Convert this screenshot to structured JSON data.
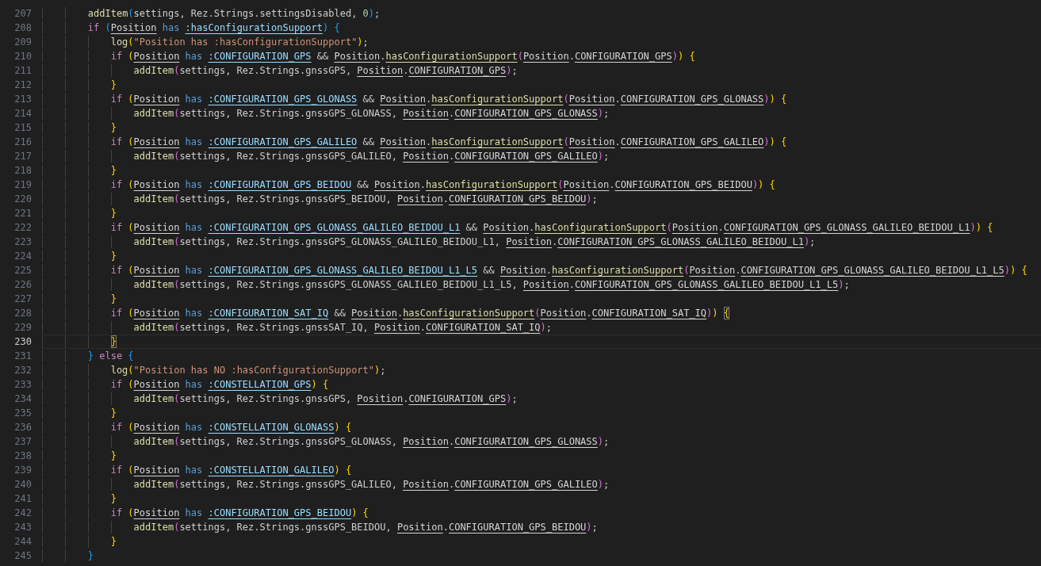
{
  "editor": {
    "lines": [
      {
        "number": "207",
        "current": false,
        "tokens": [
          {
            "kind": "fn",
            "text": "addItem"
          },
          {
            "kind": "b3",
            "text": "("
          },
          {
            "kind": "plain",
            "text": "settings, Rez.Strings.settingsDisabled,",
            "spaced": true
          },
          {
            "kind": "num",
            "text": "0"
          },
          {
            "kind": "b3",
            "text": ")"
          },
          {
            "kind": "plain",
            "text": ";"
          }
        ]
      },
      {
        "number": "208",
        "current": false,
        "tokens": [
          {
            "kind": "kw",
            "text": "if",
            "spaced": true
          },
          {
            "kind": "b3",
            "text": "("
          },
          {
            "kind": "mod",
            "text": "Position",
            "spaced": true
          },
          {
            "kind": "op",
            "text": "has",
            "spaced": true
          },
          {
            "kind": "sym",
            "text": ":hasConfigurationSupport"
          },
          {
            "kind": "b3",
            "text": ")",
            "spaced": true
          },
          {
            "kind": "b3",
            "text": "{"
          }
        ],
        "children": [
          {
            "number": "209",
            "current": false,
            "tokens": [
              {
                "kind": "fn",
                "text": "log"
              },
              {
                "kind": "b1",
                "text": "("
              },
              {
                "kind": "str",
                "text": "\"Position has :hasConfigurationSupport\""
              },
              {
                "kind": "b1",
                "text": ")"
              },
              {
                "kind": "plain",
                "text": ";"
              }
            ]
          },
          {
            "number": "210",
            "current": false,
            "tokens": [
              {
                "kind": "kw",
                "text": "if",
                "spaced": true
              },
              {
                "kind": "b1",
                "text": "("
              },
              {
                "kind": "mod",
                "text": "Position",
                "spaced": true
              },
              {
                "kind": "op",
                "text": "has",
                "spaced": true
              },
              {
                "kind": "sym",
                "text": ":CONFIGURATION_GPS",
                "spaced": true
              },
              {
                "kind": "plain",
                "text": "&&",
                "spaced": true
              },
              {
                "kind": "mod",
                "text": "Position"
              },
              {
                "kind": "plain",
                "text": "."
              },
              {
                "kind": "method",
                "text": "hasConfigurationSupport"
              },
              {
                "kind": "b2",
                "text": "("
              },
              {
                "kind": "mod",
                "text": "Position"
              },
              {
                "kind": "plain",
                "text": "."
              },
              {
                "kind": "const",
                "text": "CONFIGURATION_GPS"
              },
              {
                "kind": "b2",
                "text": ")"
              },
              {
                "kind": "b1",
                "text": ")",
                "spaced": true
              },
              {
                "kind": "b1",
                "text": "{"
              }
            ],
            "children": [
              {
                "number": "211",
                "current": false,
                "tokens": [
                  {
                    "kind": "fn",
                    "text": "addItem"
                  },
                  {
                    "kind": "b2",
                    "text": "("
                  },
                  {
                    "kind": "plain",
                    "text": "settings, Rez.Strings.gnssGPS,",
                    "spaced": true
                  },
                  {
                    "kind": "mod",
                    "text": "Position"
                  },
                  {
                    "kind": "plain",
                    "text": "."
                  },
                  {
                    "kind": "const",
                    "text": "CONFIGURATION_GPS"
                  },
                  {
                    "kind": "b2",
                    "text": ")"
                  },
                  {
                    "kind": "plain",
                    "text": ";"
                  }
                ]
              }
            ]
          },
          {
            "number": "212",
            "current": false,
            "tokens": [
              {
                "kind": "b1",
                "text": "}"
              }
            ]
          },
          {
            "number": "213",
            "current": false,
            "tokens": [
              {
                "kind": "kw",
                "text": "if",
                "spaced": true
              },
              {
                "kind": "b1",
                "text": "("
              },
              {
                "kind": "mod",
                "text": "Position",
                "spaced": true
              },
              {
                "kind": "op",
                "text": "has",
                "spaced": true
              },
              {
                "kind": "sym",
                "text": ":CONFIGURATION_GPS_GLONASS",
                "spaced": true
              },
              {
                "kind": "plain",
                "text": "&&",
                "spaced": true
              },
              {
                "kind": "mod",
                "text": "Position"
              },
              {
                "kind": "plain",
                "text": "."
              },
              {
                "kind": "method",
                "text": "hasConfigurationSupport"
              },
              {
                "kind": "b2",
                "text": "("
              },
              {
                "kind": "mod",
                "text": "Position"
              },
              {
                "kind": "plain",
                "text": "."
              },
              {
                "kind": "const",
                "text": "CONFIGURATION_GPS_GLONASS"
              },
              {
                "kind": "b2",
                "text": ")"
              },
              {
                "kind": "b1",
                "text": ")",
                "spaced": true
              },
              {
                "kind": "b1",
                "text": "{"
              }
            ],
            "children": [
              {
                "number": "214",
                "current": false,
                "tokens": [
                  {
                    "kind": "fn",
                    "text": "addItem"
                  },
                  {
                    "kind": "b2",
                    "text": "("
                  },
                  {
                    "kind": "plain",
                    "text": "settings, Rez.Strings.gnssGPS_GLONASS,",
                    "spaced": true
                  },
                  {
                    "kind": "mod",
                    "text": "Position"
                  },
                  {
                    "kind": "plain",
                    "text": "."
                  },
                  {
                    "kind": "const",
                    "text": "CONFIGURATION_GPS_GLONASS"
                  },
                  {
                    "kind": "b2",
                    "text": ")"
                  },
                  {
                    "kind": "plain",
                    "text": ";"
                  }
                ]
              }
            ]
          },
          {
            "number": "215",
            "current": false,
            "tokens": [
              {
                "kind": "b1",
                "text": "}"
              }
            ]
          },
          {
            "number": "216",
            "current": false,
            "tokens": [
              {
                "kind": "kw",
                "text": "if",
                "spaced": true
              },
              {
                "kind": "b1",
                "text": "("
              },
              {
                "kind": "mod",
                "text": "Position",
                "spaced": true
              },
              {
                "kind": "op",
                "text": "has",
                "spaced": true
              },
              {
                "kind": "sym",
                "text": ":CONFIGURATION_GPS_GALILEO",
                "spaced": true
              },
              {
                "kind": "plain",
                "text": "&&",
                "spaced": true
              },
              {
                "kind": "mod",
                "text": "Position"
              },
              {
                "kind": "plain",
                "text": "."
              },
              {
                "kind": "method",
                "text": "hasConfigurationSupport"
              },
              {
                "kind": "b2",
                "text": "("
              },
              {
                "kind": "mod",
                "text": "Position"
              },
              {
                "kind": "plain",
                "text": "."
              },
              {
                "kind": "const",
                "text": "CONFIGURATION_GPS_GALILEO"
              },
              {
                "kind": "b2",
                "text": ")"
              },
              {
                "kind": "b1",
                "text": ")",
                "spaced": true
              },
              {
                "kind": "b1",
                "text": "{"
              }
            ],
            "children": [
              {
                "number": "217",
                "current": false,
                "tokens": [
                  {
                    "kind": "fn",
                    "text": "addItem"
                  },
                  {
                    "kind": "b2",
                    "text": "("
                  },
                  {
                    "kind": "plain",
                    "text": "settings, Rez.Strings.gnssGPS_GALILEO,",
                    "spaced": true
                  },
                  {
                    "kind": "mod",
                    "text": "Position"
                  },
                  {
                    "kind": "plain",
                    "text": "."
                  },
                  {
                    "kind": "const",
                    "text": "CONFIGURATION_GPS_GALILEO"
                  },
                  {
                    "kind": "b2",
                    "text": ")"
                  },
                  {
                    "kind": "plain",
                    "text": ";"
                  }
                ]
              }
            ]
          },
          {
            "number": "218",
            "current": false,
            "tokens": [
              {
                "kind": "b1",
                "text": "}"
              }
            ]
          },
          {
            "number": "219",
            "current": false,
            "tokens": [
              {
                "kind": "kw",
                "text": "if",
                "spaced": true
              },
              {
                "kind": "b1",
                "text": "("
              },
              {
                "kind": "mod",
                "text": "Position",
                "spaced": true
              },
              {
                "kind": "op",
                "text": "has",
                "spaced": true
              },
              {
                "kind": "sym",
                "text": ":CONFIGURATION_GPS_BEIDOU",
                "spaced": true
              },
              {
                "kind": "plain",
                "text": "&&",
                "spaced": true
              },
              {
                "kind": "mod",
                "text": "Position"
              },
              {
                "kind": "plain",
                "text": "."
              },
              {
                "kind": "method",
                "text": "hasConfigurationSupport"
              },
              {
                "kind": "b2",
                "text": "("
              },
              {
                "kind": "mod",
                "text": "Position"
              },
              {
                "kind": "plain",
                "text": "."
              },
              {
                "kind": "const",
                "text": "CONFIGURATION_GPS_BEIDOU"
              },
              {
                "kind": "b2",
                "text": ")"
              },
              {
                "kind": "b1",
                "text": ")",
                "spaced": true
              },
              {
                "kind": "b1",
                "text": "{"
              }
            ],
            "children": [
              {
                "number": "220",
                "current": false,
                "tokens": [
                  {
                    "kind": "fn",
                    "text": "addItem"
                  },
                  {
                    "kind": "b2",
                    "text": "("
                  },
                  {
                    "kind": "plain",
                    "text": "settings, Rez.Strings.gnssGPS_BEIDOU,",
                    "spaced": true
                  },
                  {
                    "kind": "mod",
                    "text": "Position"
                  },
                  {
                    "kind": "plain",
                    "text": "."
                  },
                  {
                    "kind": "const",
                    "text": "CONFIGURATION_GPS_BEIDOU"
                  },
                  {
                    "kind": "b2",
                    "text": ")"
                  },
                  {
                    "kind": "plain",
                    "text": ";"
                  }
                ]
              }
            ]
          },
          {
            "number": "221",
            "current": false,
            "tokens": [
              {
                "kind": "b1",
                "text": "}"
              }
            ]
          },
          {
            "number": "222",
            "current": false,
            "tokens": [
              {
                "kind": "kw",
                "text": "if",
                "spaced": true
              },
              {
                "kind": "b1",
                "text": "("
              },
              {
                "kind": "mod",
                "text": "Position",
                "spaced": true
              },
              {
                "kind": "op",
                "text": "has",
                "spaced": true
              },
              {
                "kind": "sym",
                "text": ":CONFIGURATION_GPS_GLONASS_GALILEO_BEIDOU_L1",
                "spaced": true
              },
              {
                "kind": "plain",
                "text": "&&",
                "spaced": true
              },
              {
                "kind": "mod",
                "text": "Position"
              },
              {
                "kind": "plain",
                "text": "."
              },
              {
                "kind": "method",
                "text": "hasConfigurationSupport"
              },
              {
                "kind": "b2",
                "text": "("
              },
              {
                "kind": "mod",
                "text": "Position"
              },
              {
                "kind": "plain",
                "text": "."
              },
              {
                "kind": "const",
                "text": "CONFIGURATION_GPS_GLONASS_GALILEO_BEIDOU_L1"
              },
              {
                "kind": "b2",
                "text": ")"
              },
              {
                "kind": "b1",
                "text": ")",
                "spaced": true
              },
              {
                "kind": "b1",
                "text": "{"
              }
            ],
            "children": [
              {
                "number": "223",
                "current": false,
                "tokens": [
                  {
                    "kind": "fn",
                    "text": "addItem"
                  },
                  {
                    "kind": "b2",
                    "text": "("
                  },
                  {
                    "kind": "plain",
                    "text": "settings, Rez.Strings.gnssGPS_GLONASS_GALILEO_BEIDOU_L1,",
                    "spaced": true
                  },
                  {
                    "kind": "mod",
                    "text": "Position"
                  },
                  {
                    "kind": "plain",
                    "text": "."
                  },
                  {
                    "kind": "const",
                    "text": "CONFIGURATION_GPS_GLONASS_GALILEO_BEIDOU_L1"
                  },
                  {
                    "kind": "b2",
                    "text": ")"
                  },
                  {
                    "kind": "plain",
                    "text": ";"
                  }
                ]
              }
            ]
          },
          {
            "number": "224",
            "current": false,
            "tokens": [
              {
                "kind": "b1",
                "text": "}"
              }
            ]
          },
          {
            "number": "225",
            "current": false,
            "tokens": [
              {
                "kind": "kw",
                "text": "if",
                "spaced": true
              },
              {
                "kind": "b1",
                "text": "("
              },
              {
                "kind": "mod",
                "text": "Position",
                "spaced": true
              },
              {
                "kind": "op",
                "text": "has",
                "spaced": true
              },
              {
                "kind": "sym",
                "text": ":CONFIGURATION_GPS_GLONASS_GALILEO_BEIDOU_L1_L5",
                "spaced": true
              },
              {
                "kind": "plain",
                "text": "&&",
                "spaced": true
              },
              {
                "kind": "mod",
                "text": "Position"
              },
              {
                "kind": "plain",
                "text": "."
              },
              {
                "kind": "method",
                "text": "hasConfigurationSupport"
              },
              {
                "kind": "b2",
                "text": "("
              },
              {
                "kind": "mod",
                "text": "Position"
              },
              {
                "kind": "plain",
                "text": "."
              },
              {
                "kind": "const",
                "text": "CONFIGURATION_GPS_GLONASS_GALILEO_BEIDOU_L1_L5"
              },
              {
                "kind": "b2",
                "text": ")"
              },
              {
                "kind": "b1",
                "text": ")",
                "spaced": true
              },
              {
                "kind": "b1",
                "text": "{"
              }
            ],
            "children": [
              {
                "number": "226",
                "current": false,
                "tokens": [
                  {
                    "kind": "fn",
                    "text": "addItem"
                  },
                  {
                    "kind": "b2",
                    "text": "("
                  },
                  {
                    "kind": "plain",
                    "text": "settings, Rez.Strings.gnssGPS_GLONASS_GALILEO_BEIDOU_L1_L5,",
                    "spaced": true
                  },
                  {
                    "kind": "mod",
                    "text": "Position"
                  },
                  {
                    "kind": "plain",
                    "text": "."
                  },
                  {
                    "kind": "const",
                    "text": "CONFIGURATION_GPS_GLONASS_GALILEO_BEIDOU_L1_L5"
                  },
                  {
                    "kind": "b2",
                    "text": ")"
                  },
                  {
                    "kind": "plain",
                    "text": ";"
                  }
                ]
              }
            ]
          },
          {
            "number": "227",
            "current": false,
            "tokens": [
              {
                "kind": "b1",
                "text": "}"
              }
            ]
          },
          {
            "number": "228",
            "current": false,
            "tokens": [
              {
                "kind": "kw",
                "text": "if",
                "spaced": true
              },
              {
                "kind": "b1",
                "text": "("
              },
              {
                "kind": "mod",
                "text": "Position",
                "spaced": true
              },
              {
                "kind": "op",
                "text": "has",
                "spaced": true
              },
              {
                "kind": "sym",
                "text": ":CONFIGURATION_SAT_IQ",
                "spaced": true
              },
              {
                "kind": "plain",
                "text": "&&",
                "spaced": true
              },
              {
                "kind": "mod",
                "text": "Position"
              },
              {
                "kind": "plain",
                "text": "."
              },
              {
                "kind": "method",
                "text": "hasConfigurationSupport"
              },
              {
                "kind": "b2",
                "text": "("
              },
              {
                "kind": "mod",
                "text": "Position"
              },
              {
                "kind": "plain",
                "text": "."
              },
              {
                "kind": "const",
                "text": "CONFIGURATION_SAT_IQ"
              },
              {
                "kind": "b2",
                "text": ")"
              },
              {
                "kind": "b1",
                "text": ")",
                "spaced": true
              },
              {
                "kind": "b1",
                "text": "{",
                "matched": true
              }
            ],
            "children": [
              {
                "number": "229",
                "current": false,
                "tokens": [
                  {
                    "kind": "fn",
                    "text": "addItem"
                  },
                  {
                    "kind": "b2",
                    "text": "("
                  },
                  {
                    "kind": "plain",
                    "text": "settings, Rez.Strings.gnssSAT_IQ,",
                    "spaced": true
                  },
                  {
                    "kind": "mod",
                    "text": "Position"
                  },
                  {
                    "kind": "plain",
                    "text": "."
                  },
                  {
                    "kind": "const",
                    "text": "CONFIGURATION_SAT_IQ"
                  },
                  {
                    "kind": "b2",
                    "text": ")"
                  },
                  {
                    "kind": "plain",
                    "text": ";"
                  }
                ]
              }
            ]
          },
          {
            "number": "230",
            "current": true,
            "tokens": [
              {
                "kind": "b1",
                "text": "}",
                "matched": true
              }
            ]
          }
        ]
      },
      {
        "number": "231",
        "current": false,
        "tokens": [
          {
            "kind": "b3",
            "text": "}",
            "spaced": true
          },
          {
            "kind": "kw",
            "text": "else",
            "spaced": true
          },
          {
            "kind": "b3",
            "text": "{"
          }
        ],
        "children": [
          {
            "number": "232",
            "current": false,
            "tokens": [
              {
                "kind": "fn",
                "text": "log"
              },
              {
                "kind": "b1",
                "text": "("
              },
              {
                "kind": "str",
                "text": "\"Position has NO :hasConfigurationSupport\""
              },
              {
                "kind": "b1",
                "text": ")"
              },
              {
                "kind": "plain",
                "text": ";"
              }
            ]
          },
          {
            "number": "233",
            "current": false,
            "tokens": [
              {
                "kind": "kw",
                "text": "if",
                "spaced": true
              },
              {
                "kind": "b1",
                "text": "("
              },
              {
                "kind": "mod",
                "text": "Position",
                "spaced": true
              },
              {
                "kind": "op",
                "text": "has",
                "spaced": true
              },
              {
                "kind": "sym",
                "text": ":CONSTELLATION_GPS"
              },
              {
                "kind": "b1",
                "text": ")",
                "spaced": true
              },
              {
                "kind": "b1",
                "text": "{"
              }
            ],
            "children": [
              {
                "number": "234",
                "current": false,
                "tokens": [
                  {
                    "kind": "fn",
                    "text": "addItem"
                  },
                  {
                    "kind": "b2",
                    "text": "("
                  },
                  {
                    "kind": "plain",
                    "text": "settings, Rez.Strings.gnssGPS,",
                    "spaced": true
                  },
                  {
                    "kind": "mod",
                    "text": "Position"
                  },
                  {
                    "kind": "plain",
                    "text": "."
                  },
                  {
                    "kind": "const",
                    "text": "CONFIGURATION_GPS"
                  },
                  {
                    "kind": "b2",
                    "text": ")"
                  },
                  {
                    "kind": "plain",
                    "text": ";"
                  }
                ]
              }
            ]
          },
          {
            "number": "235",
            "current": false,
            "tokens": [
              {
                "kind": "b1",
                "text": "}"
              }
            ]
          },
          {
            "number": "236",
            "current": false,
            "tokens": [
              {
                "kind": "kw",
                "text": "if",
                "spaced": true
              },
              {
                "kind": "b1",
                "text": "("
              },
              {
                "kind": "mod",
                "text": "Position",
                "spaced": true
              },
              {
                "kind": "op",
                "text": "has",
                "spaced": true
              },
              {
                "kind": "sym",
                "text": ":CONSTELLATION_GLONASS"
              },
              {
                "kind": "b1",
                "text": ")",
                "spaced": true
              },
              {
                "kind": "b1",
                "text": "{"
              }
            ],
            "children": [
              {
                "number": "237",
                "current": false,
                "tokens": [
                  {
                    "kind": "fn",
                    "text": "addItem"
                  },
                  {
                    "kind": "b2",
                    "text": "("
                  },
                  {
                    "kind": "plain",
                    "text": "settings, Rez.Strings.gnssGPS_GLONASS,",
                    "spaced": true
                  },
                  {
                    "kind": "mod",
                    "text": "Position"
                  },
                  {
                    "kind": "plain",
                    "text": "."
                  },
                  {
                    "kind": "const",
                    "text": "CONFIGURATION_GPS_GLONASS"
                  },
                  {
                    "kind": "b2",
                    "text": ")"
                  },
                  {
                    "kind": "plain",
                    "text": ";"
                  }
                ]
              }
            ]
          },
          {
            "number": "238",
            "current": false,
            "tokens": [
              {
                "kind": "b1",
                "text": "}"
              }
            ]
          },
          {
            "number": "239",
            "current": false,
            "tokens": [
              {
                "kind": "kw",
                "text": "if",
                "spaced": true
              },
              {
                "kind": "b1",
                "text": "("
              },
              {
                "kind": "mod",
                "text": "Position",
                "spaced": true
              },
              {
                "kind": "op",
                "text": "has",
                "spaced": true
              },
              {
                "kind": "sym",
                "text": ":CONSTELLATION_GALILEO"
              },
              {
                "kind": "b1",
                "text": ")",
                "spaced": true
              },
              {
                "kind": "b1",
                "text": "{"
              }
            ],
            "children": [
              {
                "number": "240",
                "current": false,
                "tokens": [
                  {
                    "kind": "fn",
                    "text": "addItem"
                  },
                  {
                    "kind": "b2",
                    "text": "("
                  },
                  {
                    "kind": "plain",
                    "text": "settings, Rez.Strings.gnssGPS_GALILEO,",
                    "spaced": true
                  },
                  {
                    "kind": "mod",
                    "text": "Position"
                  },
                  {
                    "kind": "plain",
                    "text": "."
                  },
                  {
                    "kind": "const",
                    "text": "CONFIGURATION_GPS_GALILEO"
                  },
                  {
                    "kind": "b2",
                    "text": ")"
                  },
                  {
                    "kind": "plain",
                    "text": ";"
                  }
                ]
              }
            ]
          },
          {
            "number": "241",
            "current": false,
            "tokens": [
              {
                "kind": "b1",
                "text": "}"
              }
            ]
          },
          {
            "number": "242",
            "current": false,
            "tokens": [
              {
                "kind": "kw",
                "text": "if",
                "spaced": true
              },
              {
                "kind": "b1",
                "text": "("
              },
              {
                "kind": "mod",
                "text": "Position",
                "spaced": true
              },
              {
                "kind": "op",
                "text": "has",
                "spaced": true
              },
              {
                "kind": "sym",
                "text": ":CONFIGURATION_GPS_BEIDOU"
              },
              {
                "kind": "b1",
                "text": ")",
                "spaced": true
              },
              {
                "kind": "b1",
                "text": "{"
              }
            ],
            "children": [
              {
                "number": "243",
                "current": false,
                "tokens": [
                  {
                    "kind": "fn",
                    "text": "addItem"
                  },
                  {
                    "kind": "b2",
                    "text": "("
                  },
                  {
                    "kind": "plain",
                    "text": "settings, Rez.Strings.gnssGPS_BEIDOU,",
                    "spaced": true
                  },
                  {
                    "kind": "mod",
                    "text": "Position"
                  },
                  {
                    "kind": "plain",
                    "text": "."
                  },
                  {
                    "kind": "const",
                    "text": "CONFIGURATION_GPS_BEIDOU"
                  },
                  {
                    "kind": "b2",
                    "text": ")"
                  },
                  {
                    "kind": "plain",
                    "text": ";"
                  }
                ]
              }
            ]
          },
          {
            "number": "244",
            "current": false,
            "tokens": [
              {
                "kind": "b1",
                "text": "}"
              }
            ]
          }
        ]
      },
      {
        "number": "245",
        "current": false,
        "tokens": [
          {
            "kind": "b3",
            "text": "}"
          }
        ]
      }
    ]
  }
}
